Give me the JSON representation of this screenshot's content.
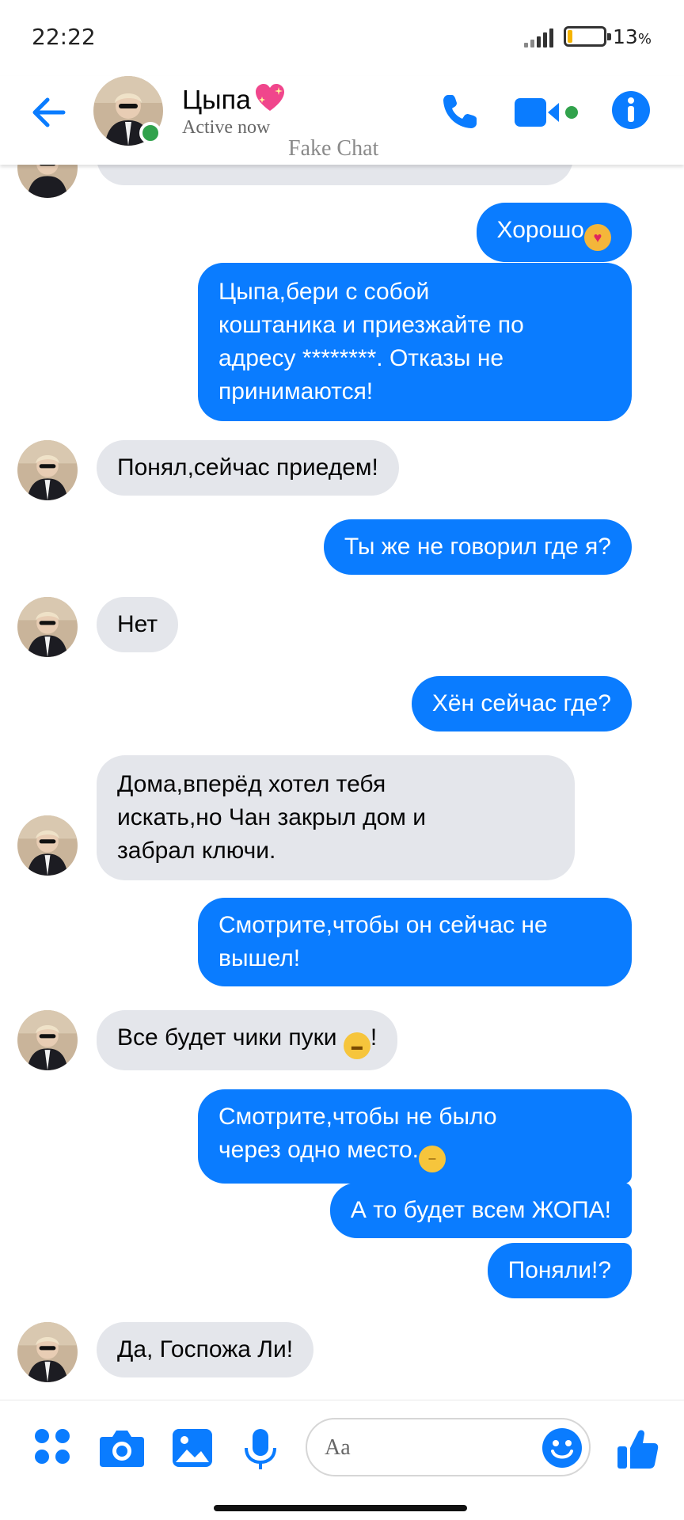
{
  "status_bar": {
    "time": "22:22",
    "battery_percent_text": "13",
    "battery_percent_unit": "%",
    "battery_level": 0.13
  },
  "header": {
    "contact_name": "Цыпа",
    "status": "Active now",
    "watermark": "Fake Chat",
    "accent_color": "#0a7cff",
    "online_color": "#31a24c"
  },
  "messages": [
    {
      "dir": "out",
      "text": "Хорошо",
      "emoji": "smiling-cat-heart-eyes"
    },
    {
      "dir": "out",
      "lines": [
        "Цыпа,бери с собой",
        "коштаника и приезжайте по",
        "адресу ********. Отказы не",
        "принимаются!"
      ]
    },
    {
      "dir": "in",
      "text": "Понял,сейчас приедем!"
    },
    {
      "dir": "out",
      "text": "Ты же не говорил где я?"
    },
    {
      "dir": "in",
      "text": "Нет"
    },
    {
      "dir": "out",
      "text": "Хён сейчас где?"
    },
    {
      "dir": "in",
      "lines": [
        "Дома,вперёд хотел тебя",
        "искать,но Чан закрыл дом и",
        "забрал ключи."
      ]
    },
    {
      "dir": "out",
      "lines": [
        "Смотрите,чтобы он сейчас не",
        "вышел!"
      ]
    },
    {
      "dir": "in",
      "text": "Все будет чики пуки ",
      "emoji": "grinning-face",
      "suffix": "!"
    },
    {
      "dir": "out",
      "lines": [
        "Смотрите,чтобы не было",
        "через одно место."
      ],
      "emoji": "expressionless-face"
    },
    {
      "dir": "out",
      "text": "А то будет всем ЖОПА!"
    },
    {
      "dir": "out",
      "text": "Поняли!?"
    },
    {
      "dir": "in",
      "text": "Да, Госпожа Ли!"
    }
  ],
  "composer": {
    "placeholder": "Aa"
  },
  "colors": {
    "outgoing_bubble": "#0a7cff",
    "incoming_bubble": "#e4e6eb"
  }
}
